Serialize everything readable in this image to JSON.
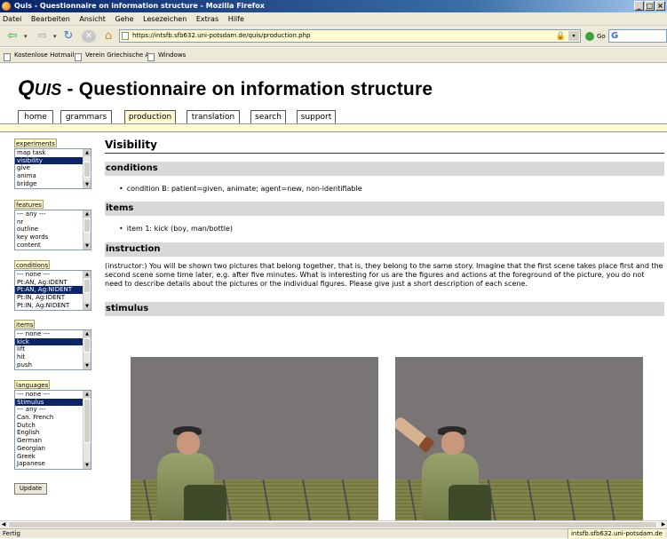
{
  "window": {
    "title": "Quis - Questionnaire on information structure - Mozilla Firefox",
    "buttons": [
      "_",
      "□",
      "×"
    ]
  },
  "menu": [
    "Datei",
    "Bearbeiten",
    "Ansicht",
    "Gehe",
    "Lesezeichen",
    "Extras",
    "Hilfe"
  ],
  "nav": {
    "back_glyph": "⇦",
    "forward_glyph": "⇨",
    "reload_glyph": "↻",
    "stop_glyph": "✕",
    "home_glyph": "⌂",
    "dropdown_glyph": "▾",
    "url": "https://intsfb.sfb632.uni-potsdam.de/quis/production.php",
    "lock_glyph": "🔒",
    "go_label": "Go",
    "search_glyph": "G"
  },
  "bookmarks": [
    "Kostenlose Hotmail",
    "Verein Griechische A...",
    "Windows"
  ],
  "site": {
    "title_q": "Q",
    "title_uis": "UIS",
    "title_rest": " - Questionnaire on information structure"
  },
  "tabs": [
    {
      "label": "home",
      "active": false
    },
    {
      "label": "grammars",
      "active": false
    },
    {
      "label": "production",
      "active": true
    },
    {
      "label": "translation",
      "active": false
    },
    {
      "label": "search",
      "active": false
    },
    {
      "label": "support",
      "active": false
    }
  ],
  "sidebar": {
    "experiments": {
      "label": "experiments",
      "options": [
        "map task",
        "visibility",
        "give",
        "anima",
        "bridge"
      ],
      "selected": "visibility"
    },
    "features": {
      "label": "features",
      "options": [
        "--- any ---",
        "nr",
        "outline",
        "key words",
        "content"
      ],
      "selected": ""
    },
    "conditions": {
      "label": "conditions",
      "options": [
        "--- none ---",
        "Pt:AN, Ag:IDENT",
        "Pt:AN, Ag:NIDENT",
        "Pt:IN, Ag:IDENT",
        "Pt:IN, Ag:NIDENT"
      ],
      "selected": "Pt:AN, Ag:NIDENT"
    },
    "items": {
      "label": "items",
      "options": [
        "--- none ---",
        "kick",
        "lift",
        "hit",
        "push"
      ],
      "selected": "kick"
    },
    "languages": {
      "label": "languages",
      "options": [
        "--- none ---",
        "Stimulus",
        "--- any ---",
        "Can. French",
        "Dutch",
        "English",
        "German",
        "Georgian",
        "Greek",
        "Japanese"
      ],
      "selected": "Stimulus"
    },
    "update_label": "Update"
  },
  "content": {
    "title": "Visibility",
    "conditions_heading": "conditions",
    "condition_text": "condition B: patient=given, animate; agent=new, non-identifiable",
    "items_heading": "items",
    "item_text": "item 1: kick (boy, man/bottle)",
    "instruction_heading": "instruction",
    "instruction_text": "(instructor:) You will be shown two pictures that belong together, that is, they belong to the same story. Imagine that the first scene takes place first and the second scene some time later, e.g. after five minutes. What is interesting for us are the figures and actions at the foreground of the picture, you do not need to describe details about the pictures or the individual figures. Please give just a short description of each scene.",
    "stimulus_heading": "stimulus"
  },
  "status": {
    "left": "Fertig",
    "right": "intsfb.sfb632.uni-potsdam.de"
  }
}
